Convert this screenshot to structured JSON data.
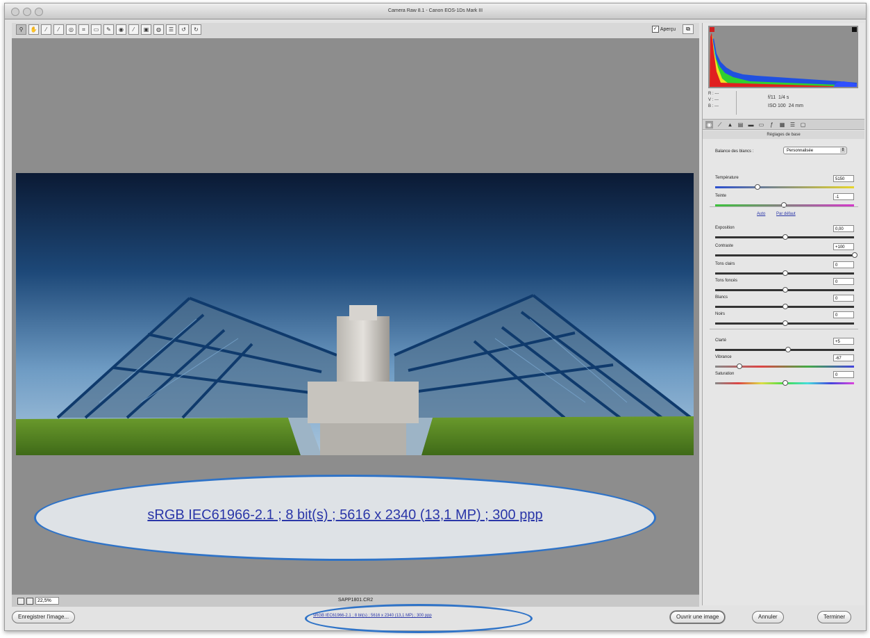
{
  "window": {
    "title": "Camera Raw 8.1  -  Canon EOS-1Ds Mark III"
  },
  "toolbar": {
    "tools": [
      {
        "icon": "zoom-icon",
        "glyph": "⚲"
      },
      {
        "icon": "hand-icon",
        "glyph": "✋"
      },
      {
        "icon": "white-balance-icon",
        "glyph": "⁄"
      },
      {
        "icon": "color-sampler-icon",
        "glyph": "⁄"
      },
      {
        "icon": "targeted-adjustment-icon",
        "glyph": "◎"
      },
      {
        "icon": "crop-icon",
        "glyph": "⌗"
      },
      {
        "icon": "straighten-icon",
        "glyph": "▭"
      },
      {
        "icon": "spot-removal-icon",
        "glyph": "✎"
      },
      {
        "icon": "red-eye-icon",
        "glyph": "◉"
      },
      {
        "icon": "brush-icon",
        "glyph": "⁄"
      },
      {
        "icon": "graduated-filter-icon",
        "glyph": "▣"
      },
      {
        "icon": "radial-filter-icon",
        "glyph": "◍"
      },
      {
        "icon": "preferences-icon",
        "glyph": "☰"
      },
      {
        "icon": "rotate-left-icon",
        "glyph": "↺"
      },
      {
        "icon": "rotate-right-icon",
        "glyph": "↻"
      }
    ],
    "preview_label": "Aperçu",
    "preview_checked": true
  },
  "callout": {
    "text": "sRGB IEC61966-2.1 ; 8 bit(s) ; 5616 x 2340 (13,1 MP) ; 300 ppp"
  },
  "statusbar": {
    "zoom_value": "22,5%",
    "filename": "SAPP1801.CR2"
  },
  "bottom": {
    "save_label": "Enregistrer l'image...",
    "workflow_link": "sRGB IEC61966-2.1 ; 8 bit(s) ; 5616 x 2340 (13,1 MP) ; 300 ppp",
    "open_label": "Ouvrir une image",
    "cancel_label": "Annuler",
    "done_label": "Terminer"
  },
  "readout": {
    "r": "R :  ---",
    "v": "V :  ---",
    "b": "B :  ---",
    "aperture": "f/11",
    "shutter": "1/4 s",
    "iso": "ISO 100",
    "focal": "24 mm"
  },
  "panel": {
    "section_title": "Réglages de base",
    "wb_label": "Balance des blancs :",
    "wb_value": "Personnalisée",
    "auto_link": "Auto",
    "default_link": "Par défaut",
    "sliders": [
      {
        "label": "Température",
        "value": "5150",
        "level": 0.3
      },
      {
        "label": "Teinte",
        "value": "-1",
        "level": 0.49
      },
      {
        "label": "Exposition",
        "value": "0,00",
        "level": 0.5
      },
      {
        "label": "Contraste",
        "value": "+100",
        "level": 1.0
      },
      {
        "label": "Tons clairs",
        "value": "0",
        "level": 0.5
      },
      {
        "label": "Tons foncés",
        "value": "0",
        "level": 0.5
      },
      {
        "label": "Blancs",
        "value": "0",
        "level": 0.5
      },
      {
        "label": "Noirs",
        "value": "0",
        "level": 0.5
      },
      {
        "label": "Clarté",
        "value": "+5",
        "level": 0.52
      },
      {
        "label": "Vibrance",
        "value": "-67",
        "level": 0.17
      },
      {
        "label": "Saturation",
        "value": "0",
        "level": 0.5
      }
    ]
  },
  "colors": {
    "accent_blue": "#2f73c7",
    "link_blue": "#2a36a8"
  }
}
